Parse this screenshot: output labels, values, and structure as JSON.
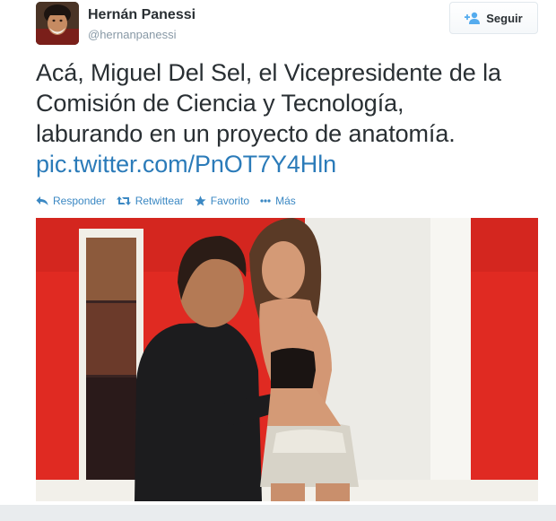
{
  "author": {
    "name": "Hernán Panessi",
    "handle": "@hernanpanessi"
  },
  "follow_button": {
    "label": "Seguir",
    "icon": "add-user-icon"
  },
  "tweet": {
    "lines": [
      "Acá, Miguel Del Sel, el Vicepresidente de la",
      "Comisión de Ciencia y Tecnología,",
      "laburando en un proyecto de anatomía."
    ],
    "link": "pic.twitter.com/PnOT7Y4Hln"
  },
  "actions": [
    {
      "label": "Responder",
      "icon": "reply-icon"
    },
    {
      "label": "Retwittear",
      "icon": "retweet-icon"
    },
    {
      "label": "Favorito",
      "icon": "star-icon"
    },
    {
      "label": "Más",
      "icon": "more-dots-icon"
    }
  ],
  "colors": {
    "link": "#2b7bb9",
    "action": "#3b88c3",
    "photo_background": "#e22a22"
  }
}
